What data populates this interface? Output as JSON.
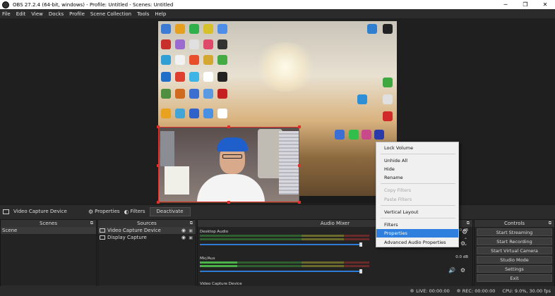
{
  "window": {
    "title": "OBS 27.2.4 (64-bit, windows) - Profile: Untitled - Scenes: Untitled",
    "min": "─",
    "max": "❐",
    "close": "✕"
  },
  "menu": [
    "File",
    "Edit",
    "View",
    "Docks",
    "Profile",
    "Scene Collection",
    "Tools",
    "Help"
  ],
  "source_toolbar": {
    "device": "Video Capture Device",
    "properties": "Properties",
    "filters": "Filters",
    "deactivate": "Deactivate"
  },
  "context_menu": {
    "items": [
      {
        "label": "Lock Volume",
        "state": "normal"
      },
      {
        "label": "Unhide All",
        "state": "normal"
      },
      {
        "label": "Hide",
        "state": "normal"
      },
      {
        "label": "Rename",
        "state": "normal"
      },
      {
        "label": "Copy Filters",
        "state": "disabled"
      },
      {
        "label": "Paste Filters",
        "state": "disabled"
      },
      {
        "label": "Vertical Layout",
        "state": "normal"
      },
      {
        "label": "Filters",
        "state": "normal"
      },
      {
        "label": "Properties",
        "state": "highlighted"
      },
      {
        "label": "Advanced Audio Properties",
        "state": "normal"
      }
    ]
  },
  "docks": {
    "scenes": {
      "title": "Scenes",
      "items": [
        "Scene"
      ]
    },
    "sources": {
      "title": "Sources",
      "items": [
        "Video Capture Device",
        "Display Capture"
      ]
    },
    "audio_mixer": {
      "title": "Audio Mixer",
      "channels": [
        {
          "name": "Desktop Audio",
          "db": "0.0 dB"
        },
        {
          "name": "Mic/Aux",
          "db": "0.0 dB"
        },
        {
          "name": "Video Capture Device",
          "db": ""
        }
      ]
    },
    "controls": {
      "title": "Controls",
      "buttons": [
        "Start Streaming",
        "Start Recording",
        "Start Virtual Camera",
        "Studio Mode",
        "Settings",
        "Exit"
      ]
    }
  },
  "status": {
    "live": "LIVE: 00:00:00",
    "rec": "REC: 00:00:00",
    "cpu": "CPU: 9.0%, 30.00 fps"
  },
  "colors": {
    "accent": "#2f7fde",
    "selection": "#e0302c",
    "meter_green": "#49b34a"
  }
}
